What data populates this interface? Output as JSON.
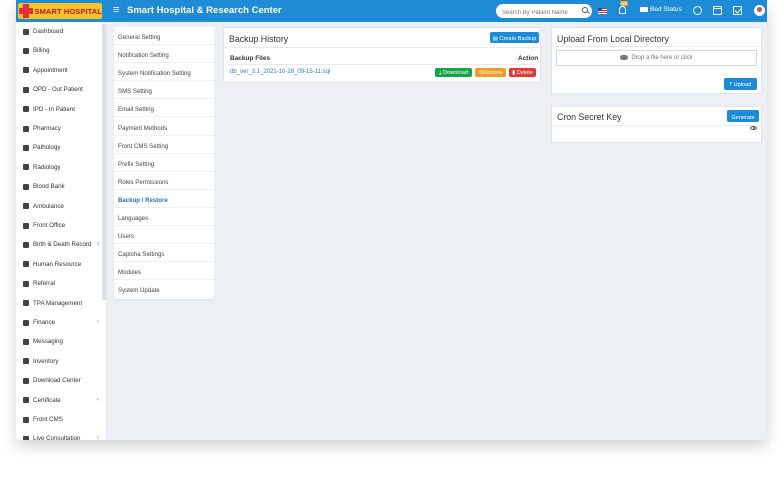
{
  "header": {
    "logo_text": "SMART HOSPITAL",
    "menu_toggle": "≡",
    "title": "Smart Hospital & Research Center",
    "search_placeholder": "Search By Patient Name",
    "notification_badge": "99",
    "bed_status": "Bed Status"
  },
  "sidebar": {
    "items": [
      {
        "label": "Dashboard",
        "icon": "monitor-icon"
      },
      {
        "label": "Billing",
        "icon": "file-icon"
      },
      {
        "label": "Appointment",
        "icon": "calendar-icon"
      },
      {
        "label": "OPD - Out Patient",
        "icon": "stethoscope-icon"
      },
      {
        "label": "IPD - In Patient",
        "icon": "bed-icon"
      },
      {
        "label": "Pharmacy",
        "icon": "mortar-pestle-icon"
      },
      {
        "label": "Pathology",
        "icon": "flask-icon"
      },
      {
        "label": "Radiology",
        "icon": "microscope-icon"
      },
      {
        "label": "Blood Bank",
        "icon": "tint-icon"
      },
      {
        "label": "Ambulance",
        "icon": "ambulance-icon"
      },
      {
        "label": "Front Office",
        "icon": "building-icon"
      },
      {
        "label": "Birth & Death Record",
        "icon": "family-icon",
        "expandable": true
      },
      {
        "label": "Human Resource",
        "icon": "sitemap-icon"
      },
      {
        "label": "Referral",
        "icon": "users-icon"
      },
      {
        "label": "TPA Management",
        "icon": "umbrella-icon"
      },
      {
        "label": "Finance",
        "icon": "money-icon",
        "expandable": true
      },
      {
        "label": "Messaging",
        "icon": "bullhorn-icon"
      },
      {
        "label": "Inventory",
        "icon": "boxes-icon"
      },
      {
        "label": "Download Center",
        "icon": "download-icon"
      },
      {
        "label": "Certificate",
        "icon": "certificate-icon",
        "expandable": true
      },
      {
        "label": "Front CMS",
        "icon": "newspaper-icon"
      },
      {
        "label": "Live Consultation",
        "icon": "video-icon",
        "expandable": true
      }
    ],
    "chevron": "‹"
  },
  "settings_menu": {
    "items": [
      "General Setting",
      "Notification Setting",
      "System Notification Setting",
      "SMS Setting",
      "Email Setting",
      "Payment Methods",
      "Front CMS Setting",
      "Prefix Setting",
      "Roles Permissions",
      "Backup / Restore",
      "Languages",
      "Users",
      "Captcha Settings",
      "Modules",
      "System Update"
    ],
    "active": "Backup / Restore"
  },
  "backup_history": {
    "title": "Backup History",
    "create_button": "Create Backup",
    "col_files": "Backup Files",
    "col_action": "Action",
    "rows": [
      {
        "file": "db_ver_3.1_2021-10-28_09-15-11.sql",
        "download": "Download",
        "restore": "Restore",
        "delete": "Delete"
      }
    ]
  },
  "upload": {
    "title": "Upload From Local Directory",
    "dropzone": "Drop a file here or click",
    "upload_button": "Upload"
  },
  "cron": {
    "title": "Cron Secret Key",
    "generate_button": "Generate"
  },
  "colors": {
    "topbar": "#1e8bd6",
    "background": "#ecf0f5",
    "accent_link": "#1e72c2",
    "download": "#13a54a",
    "restore": "#f39c24",
    "delete": "#dd3a3a"
  }
}
